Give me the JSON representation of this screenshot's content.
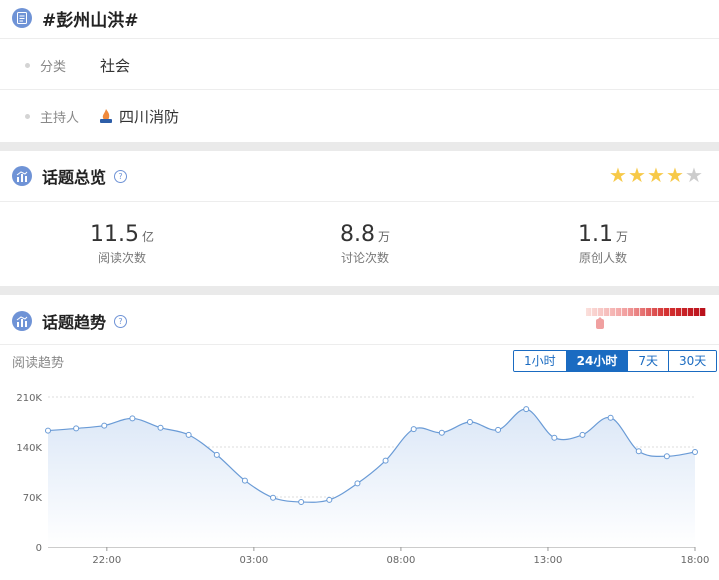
{
  "topic": {
    "hashtag": "#彭州山洪#",
    "category_label": "分类",
    "category_value": "社会",
    "host_label": "主持人",
    "host_name": "四川消防"
  },
  "overview": {
    "title": "话题总览",
    "help_label": "?",
    "rating_stars": 4,
    "rating_max": 5,
    "stats": [
      {
        "value": "11.5",
        "unit": "亿",
        "label": "阅读次数"
      },
      {
        "value": "8.8",
        "unit": "万",
        "label": "讨论次数"
      },
      {
        "value": "1.1",
        "unit": "万",
        "label": "原创人数"
      }
    ]
  },
  "trend": {
    "title": "话题趋势",
    "help_label": "?",
    "subtitle": "阅读趋势",
    "tabs": [
      "1小时",
      "24小时",
      "7天",
      "30天"
    ],
    "active_tab": 1,
    "heat_level": 0.08
  },
  "colors": {
    "accent": "#1a6bc1",
    "line": "#6a9bd6",
    "star_on": "#f7c948",
    "star_off": "#cccccc"
  },
  "chart_data": {
    "type": "area",
    "x_ticks": [
      "22:00",
      "03:00",
      "08:00",
      "13:00",
      "18:00"
    ],
    "x_tick_positions": [
      2,
      7,
      12,
      17,
      22
    ],
    "y_ticks": [
      "0",
      "70K",
      "140K",
      "210K"
    ],
    "y_tick_values": [
      0,
      70000,
      140000,
      210000
    ],
    "ylim": [
      0,
      210000
    ],
    "x": [
      0,
      1,
      2,
      3,
      4,
      5,
      6,
      7,
      8,
      9,
      10,
      11,
      12,
      13,
      14,
      15,
      16,
      17,
      18,
      19,
      20,
      21,
      22
    ],
    "values": [
      163000,
      166000,
      170000,
      180000,
      167000,
      157000,
      129000,
      93000,
      69000,
      63000,
      66000,
      89000,
      121000,
      165000,
      160000,
      175000,
      164000,
      193000,
      153000,
      157000,
      181000,
      134000,
      127000,
      133000
    ],
    "grid": true
  }
}
